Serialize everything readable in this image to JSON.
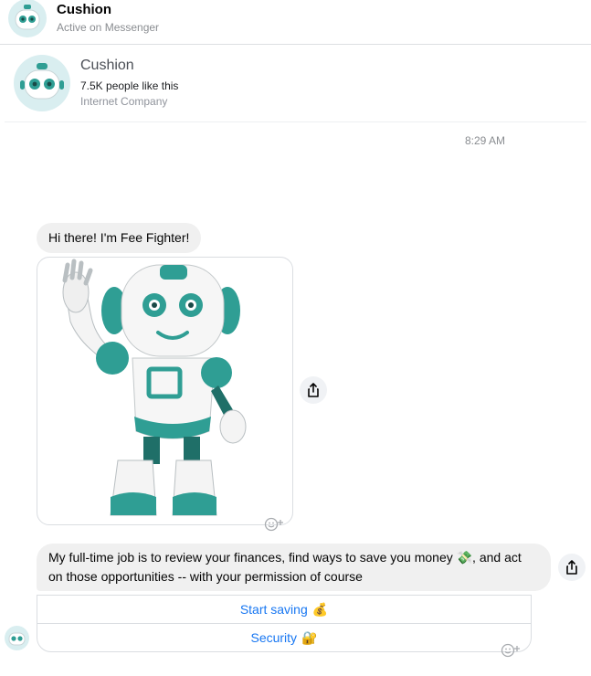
{
  "header": {
    "name": "Cushion",
    "status": "Active on Messenger"
  },
  "profile": {
    "name": "Cushion",
    "likes": "7.5K people like this",
    "category": "Internet Company"
  },
  "conversation": {
    "timestamp": "8:29 AM",
    "greeting": "Hi there! I'm Fee Fighter!",
    "message": "My full-time job is to review your finances, find ways to save you money 💸, and act on those opportunities -- with your permission of course"
  },
  "quick_replies": [
    {
      "label": "Start saving",
      "emoji": "💰"
    },
    {
      "label": "Security",
      "emoji": "🔐"
    }
  ],
  "icons": {
    "share": "share-icon",
    "reaction": "add-reaction-icon",
    "avatar": "robot-avatar-icon"
  },
  "colors": {
    "accent": "#1877f2",
    "robot_teal": "#2f9e94",
    "bubble": "#f0f0f0"
  }
}
